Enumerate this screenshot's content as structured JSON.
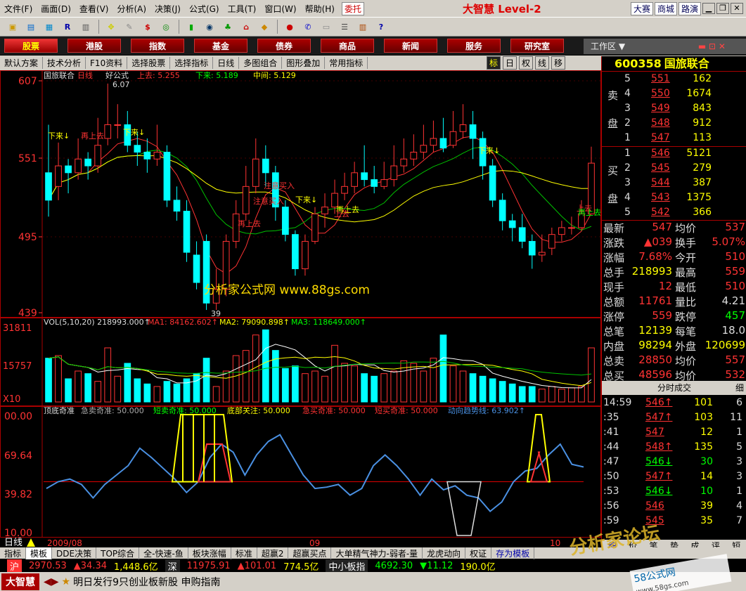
{
  "menu": [
    "文件(F)",
    "画面(D)",
    "查看(V)",
    "分析(A)",
    "决策(J)",
    "公式(G)",
    "工具(T)",
    "窗口(W)",
    "帮助(H)"
  ],
  "entrust": "委托",
  "brand": "大智慧 Level-2",
  "right_buttons": [
    "大赛",
    "商城",
    "路演"
  ],
  "nav": [
    "股票",
    "港股",
    "指数",
    "基金",
    "债券",
    "商品",
    "新闻",
    "服务",
    "研究室"
  ],
  "workarea": "工作区",
  "subbar": [
    "默认方案",
    "技术分析",
    "F10资料",
    "选择股票",
    "选择指标",
    "日线",
    "多图组合",
    "图形叠加",
    "常用指标"
  ],
  "view_tabs": [
    "标",
    "日",
    "权",
    "线",
    "移"
  ],
  "stock": {
    "code": "600358",
    "name": "国旅联合"
  },
  "main_header": {
    "name": "国旅联合",
    "period": "日线",
    "formula": "好公式",
    "up": "上去: 5.255",
    "down": "下来: 5.189",
    "mid": "中间: 5.129"
  },
  "y_main": [
    "607",
    "551",
    "495",
    "439"
  ],
  "price_high_label": "6.07",
  "price_low_label": "39",
  "vol_header": {
    "vol": "VOL(5,10,20) 218993.000↑",
    "ma1": "MA1: 84162.602↑",
    "ma2": "MA2: 79090.898↑",
    "ma3": "MA3: 118649.000↑"
  },
  "y_vol": [
    "31811",
    "15757",
    "X10"
  ],
  "ind_header": {
    "name": "顶底奇准",
    "a": "急卖奇准: 50.000",
    "b": "短卖奇准: 50.000",
    "c": "底部关注: 50.000",
    "d": "急买奇准: 50.000",
    "e": "短买奇准: 50.000",
    "f": "动向趋势线: 63.902↑"
  },
  "y_ind": [
    "00.00",
    "69.64",
    "39.82",
    "10.00"
  ],
  "x_labels": [
    "2009/08",
    "09",
    "10"
  ],
  "period_label": "日线",
  "watermark": "分析家公式网 www.88gs.com",
  "annotations": [
    {
      "t": "下来↓",
      "c": "#ff0"
    },
    {
      "t": "再上去",
      "c": "#f33"
    },
    {
      "t": "下来↓",
      "c": "#ff0"
    },
    {
      "t": "注意买入",
      "c": "#f33"
    },
    {
      "t": "注意买入",
      "c": "#f33"
    },
    {
      "t": "下来↓",
      "c": "#ff0"
    },
    {
      "t": "再上去",
      "c": "#ff0"
    },
    {
      "t": "上去",
      "c": "#f33"
    },
    {
      "t": "再上去",
      "c": "#f33"
    },
    {
      "t": "下来↓",
      "c": "#ff0"
    },
    {
      "t": "上去",
      "c": "#f33"
    },
    {
      "t": "再上去",
      "c": "#0f0"
    }
  ],
  "orderbook": {
    "sell_label": [
      "卖",
      "盘"
    ],
    "buy_label": [
      "买",
      "盘"
    ],
    "sell": [
      [
        "5",
        "551",
        "162"
      ],
      [
        "4",
        "550",
        "1674"
      ],
      [
        "3",
        "549",
        "843"
      ],
      [
        "2",
        "548",
        "912"
      ],
      [
        "1",
        "547",
        "113"
      ]
    ],
    "buy": [
      [
        "1",
        "546",
        "5121"
      ],
      [
        "2",
        "545",
        "279"
      ],
      [
        "3",
        "544",
        "387"
      ],
      [
        "4",
        "543",
        "1375"
      ],
      [
        "5",
        "542",
        "366"
      ]
    ]
  },
  "stats": [
    [
      "最新",
      "547",
      "均价",
      "537"
    ],
    [
      "涨跌",
      "▲039",
      "换手",
      "5.07%"
    ],
    [
      "涨幅",
      "7.68%",
      "今开",
      "510"
    ],
    [
      "总手",
      "218993",
      "最高",
      "559"
    ],
    [
      "现手",
      "12",
      "最低",
      "510"
    ],
    [
      "总额",
      "11761",
      "量比",
      "4.21"
    ],
    [
      "涨停",
      "559",
      "跌停",
      "457"
    ],
    [
      "总笔",
      "12139",
      "每笔",
      "18.0"
    ],
    [
      "内盘",
      "98294",
      "外盘",
      "120699"
    ],
    [
      "总卖",
      "28850",
      "均价",
      "557"
    ],
    [
      "总买",
      "48596",
      "均价",
      "532"
    ]
  ],
  "trades_header": "分时成交",
  "trades_tab": "细",
  "trades": [
    [
      "14:59",
      "546↑",
      "101",
      "6"
    ],
    [
      ":35",
      "547↑",
      "103",
      "11"
    ],
    [
      ":41",
      "547",
      "12",
      "1"
    ],
    [
      ":44",
      "548↑",
      "135",
      "5"
    ],
    [
      ":47",
      "546↓",
      "30",
      "3"
    ],
    [
      ":50",
      "547↑",
      "14",
      "3"
    ],
    [
      ":53",
      "546↓",
      "10",
      "1"
    ],
    [
      ":56",
      "546",
      "39",
      "4"
    ],
    [
      ":59",
      "545",
      "35",
      "7"
    ]
  ],
  "bottom_tabs": [
    "指标",
    "模板",
    "DDE决策",
    "TOP综合",
    "全-快速-鱼",
    "板块涨幅",
    "标准",
    "超赢2",
    "超赢买点",
    "大单精气神力-弱者-量",
    "龙虎动向",
    "权证",
    "存为模板"
  ],
  "right_mini_tabs": [
    "细",
    "价",
    "笔",
    "势",
    "成",
    "评",
    "短"
  ],
  "ticker": {
    "sh": "沪",
    "sh_index": "2970.53",
    "sh_change": "▲34.34",
    "sh_amount": "1,448.6亿",
    "sz": "深",
    "sz_index": "11975.91",
    "sz_change": "▲101.01",
    "sz_amount": "774.5亿",
    "sme": "中小板指",
    "sme_index": "4692.30",
    "sme_change": "▼11.12",
    "sme_amount": "190.0亿"
  },
  "news": "明日发行9只创业板新股 申购指南",
  "footer_brand": "大智慧",
  "corner_watermark": "分析家论坛",
  "corner_site": "58公式网",
  "corner_url": "www.58gs.com",
  "colors": {
    "up": "#ff3333",
    "down": "#00ffff",
    "ma_white": "#ffffff",
    "ma_yellow": "#ffff00",
    "ma_green": "#00c000",
    "blue_line": "#4a90e2"
  },
  "chart_data": {
    "type": "candlestick",
    "series": [
      {
        "name": "K",
        "values": [
          [
            540,
            520,
            575,
            508
          ],
          [
            530,
            545,
            562,
            520
          ],
          [
            545,
            540,
            550,
            525
          ],
          [
            540,
            550,
            565,
            535
          ],
          [
            550,
            545,
            555,
            535
          ],
          [
            545,
            560,
            580,
            540
          ],
          [
            565,
            575,
            605,
            560
          ],
          [
            575,
            575,
            590,
            565
          ],
          [
            575,
            560,
            585,
            555
          ],
          [
            560,
            555,
            570,
            545
          ],
          [
            555,
            550,
            565,
            540
          ],
          [
            550,
            555,
            575,
            545
          ],
          [
            555,
            520,
            560,
            515
          ],
          [
            520,
            512,
            530,
            505
          ],
          [
            512,
            482,
            520,
            475
          ],
          [
            480,
            460,
            490,
            455
          ],
          [
            490,
            445,
            495,
            440
          ],
          [
            445,
            455,
            470,
            440
          ],
          [
            455,
            490,
            495,
            450
          ],
          [
            490,
            510,
            520,
            485
          ],
          [
            510,
            530,
            545,
            505
          ],
          [
            530,
            550,
            565,
            525
          ],
          [
            550,
            540,
            560,
            530
          ],
          [
            540,
            515,
            545,
            505
          ],
          [
            515,
            495,
            520,
            490
          ],
          [
            495,
            470,
            498,
            465
          ],
          [
            470,
            490,
            495,
            465
          ],
          [
            490,
            510,
            515,
            488
          ],
          [
            510,
            515,
            525,
            500
          ],
          [
            515,
            525,
            535,
            510
          ],
          [
            525,
            530,
            540,
            520
          ],
          [
            530,
            540,
            548,
            525
          ],
          [
            540,
            535,
            560,
            530
          ],
          [
            535,
            530,
            545,
            525
          ],
          [
            530,
            535,
            548,
            528
          ],
          [
            535,
            545,
            560,
            530
          ],
          [
            545,
            550,
            565,
            540
          ],
          [
            550,
            555,
            568,
            545
          ],
          [
            555,
            560,
            575,
            550
          ],
          [
            560,
            565,
            578,
            555
          ],
          [
            565,
            558,
            580,
            555
          ],
          [
            560,
            570,
            585,
            558
          ],
          [
            570,
            575,
            590,
            565
          ],
          [
            575,
            565,
            585,
            550
          ],
          [
            565,
            545,
            570,
            535
          ],
          [
            545,
            520,
            550,
            515
          ],
          [
            520,
            505,
            525,
            498
          ],
          [
            505,
            500,
            510,
            490
          ],
          [
            500,
            490,
            510,
            485
          ],
          [
            490,
            480,
            495,
            470
          ],
          [
            480,
            482,
            495,
            475
          ],
          [
            485,
            495,
            500,
            480
          ],
          [
            495,
            500,
            505,
            490
          ],
          [
            500,
            500,
            508,
            495
          ],
          [
            500,
            510,
            520,
            498
          ],
          [
            510,
            547,
            559,
            510
          ]
        ]
      },
      {
        "name": "VOL",
        "values": [
          170,
          180,
          90,
          120,
          110,
          80,
          210,
          100,
          150,
          90,
          70,
          60,
          80,
          70,
          90,
          110,
          170,
          60,
          120,
          180,
          200,
          260,
          280,
          200,
          130,
          140,
          110,
          120,
          100,
          220,
          150,
          140,
          110,
          100,
          110,
          120,
          160,
          150,
          120,
          170,
          260,
          140,
          120,
          110,
          100,
          90,
          80,
          70,
          60,
          60,
          50,
          60,
          50,
          55,
          60,
          210
        ]
      },
      {
        "name": "动向趋势线",
        "values": [
          45,
          50,
          52,
          48,
          38,
          48,
          55,
          62,
          75,
          68,
          60,
          52,
          42,
          50,
          68,
          78,
          72,
          55,
          70,
          80,
          85,
          70,
          55,
          45,
          46,
          48,
          40,
          45,
          62,
          70,
          62,
          52,
          40,
          52,
          44,
          47,
          40,
          38,
          28,
          35,
          50,
          58,
          60,
          70,
          78,
          63,
          61
        ]
      }
    ],
    "title": "国旅联合 日线",
    "ylim": [
      439,
      607
    ],
    "vol_ylim": [
      0,
      31811
    ],
    "ind_ylim": [
      10,
      100
    ]
  }
}
